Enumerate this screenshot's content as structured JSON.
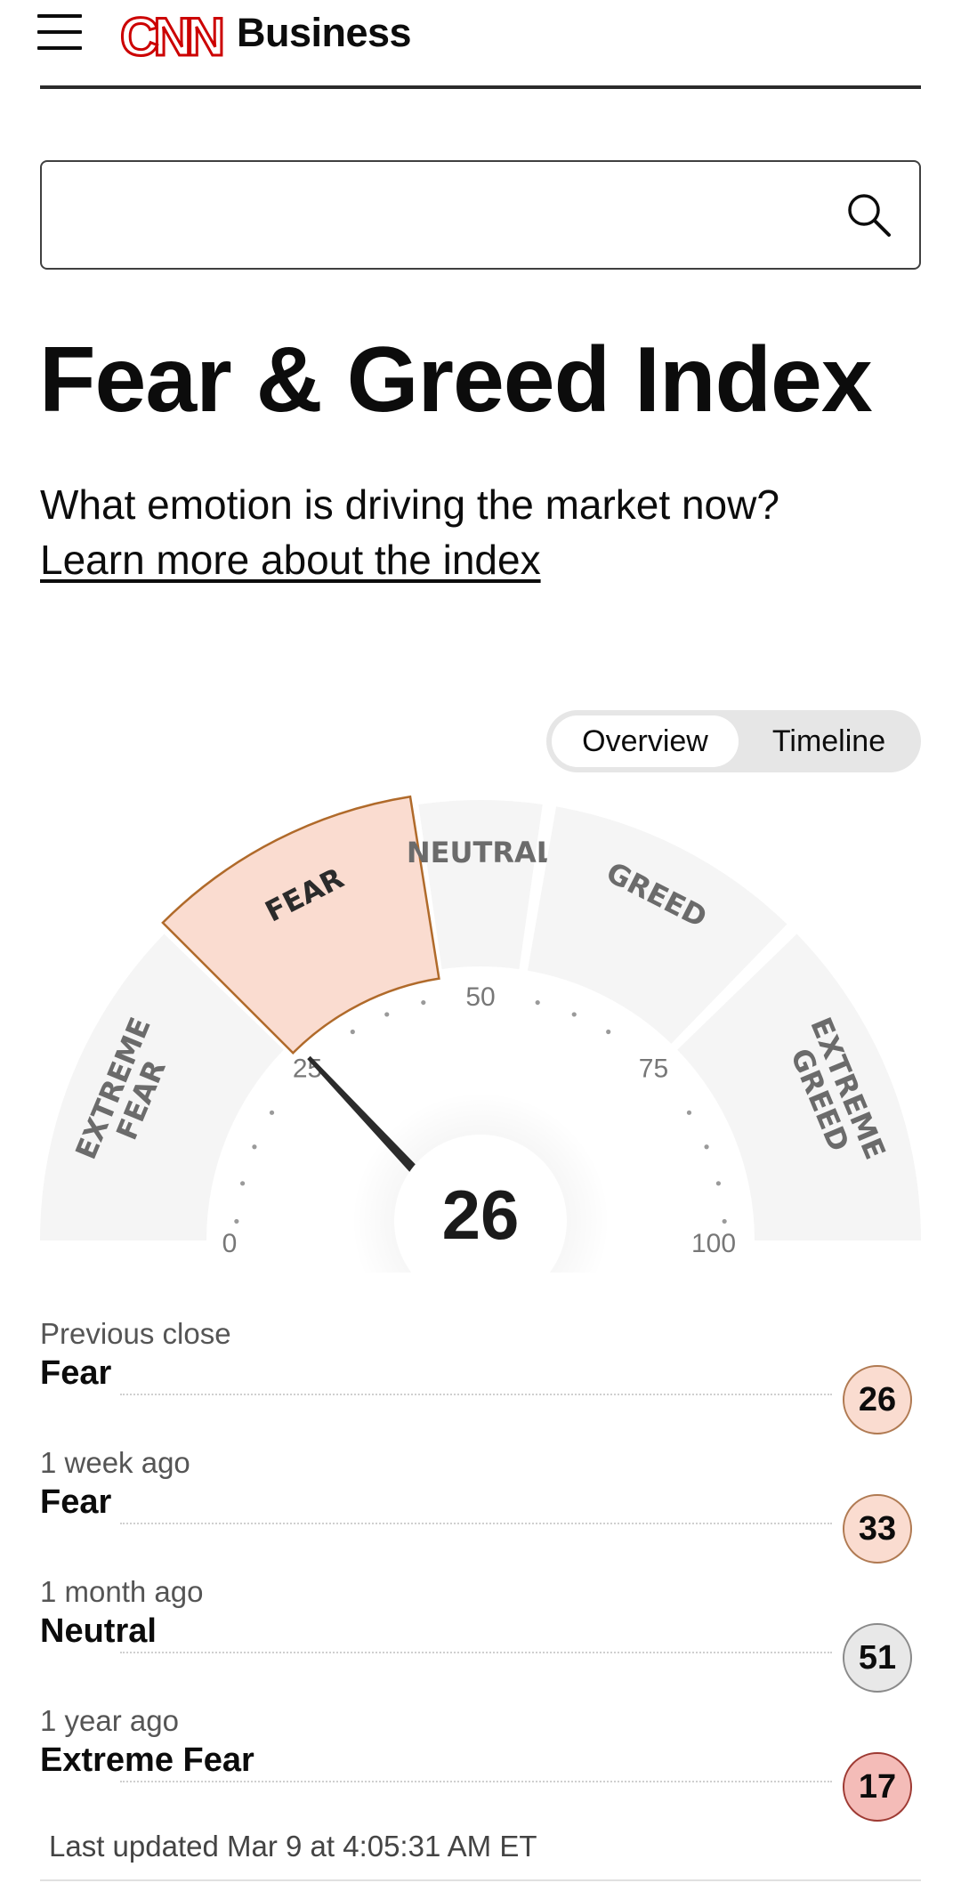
{
  "header": {
    "logo_text": "CNN",
    "section": "Business",
    "logo_color": "#cc0000"
  },
  "search": {
    "placeholder": "",
    "value": ""
  },
  "page": {
    "title": "Fear & Greed Index",
    "subtitle": "What emotion is driving the market now?",
    "learn_more": "Learn more about the index"
  },
  "view_toggle": {
    "options": [
      "Overview",
      "Timeline"
    ],
    "selected": "Overview"
  },
  "gauge": {
    "value": 26,
    "value_label": "26",
    "current_zone": "FEAR",
    "zones": [
      {
        "label": [
          "EXTREME",
          "FEAR"
        ],
        "from": 0,
        "to": 25
      },
      {
        "label": [
          "FEAR"
        ],
        "from": 25,
        "to": 45
      },
      {
        "label": [
          "NEUTRAL"
        ],
        "from": 45,
        "to": 55
      },
      {
        "label": [
          "GREED"
        ],
        "from": 55,
        "to": 75
      },
      {
        "label": [
          "EXTREME",
          "GREED"
        ],
        "from": 75,
        "to": 100
      }
    ],
    "scale_labels": [
      "0",
      "25",
      "50",
      "75",
      "100"
    ],
    "scale_values": [
      0,
      25,
      50,
      75,
      100
    ],
    "colors": {
      "zone_fill": "#f5f5f5",
      "active_fill": "#fadcd0",
      "active_stroke": "#b06a2a",
      "label_color": "#6b6b6b",
      "label_active": "#2b2b2b",
      "needle": "#2b2b2b"
    }
  },
  "history": [
    {
      "when": "Previous close",
      "rating": "Fear",
      "value": "26",
      "badge_color": "#fadcd0"
    },
    {
      "when": "1 week ago",
      "rating": "Fear",
      "value": "33",
      "badge_color": "#fadcd0"
    },
    {
      "when": "1 month ago",
      "rating": "Neutral",
      "value": "51",
      "badge_color": "#e8e8e8"
    },
    {
      "when": "1 year ago",
      "rating": "Extreme Fear",
      "value": "17",
      "badge_color": "#f4bcb8"
    }
  ],
  "last_updated": "Last updated Mar 9 at 4:05:31 AM ET"
}
